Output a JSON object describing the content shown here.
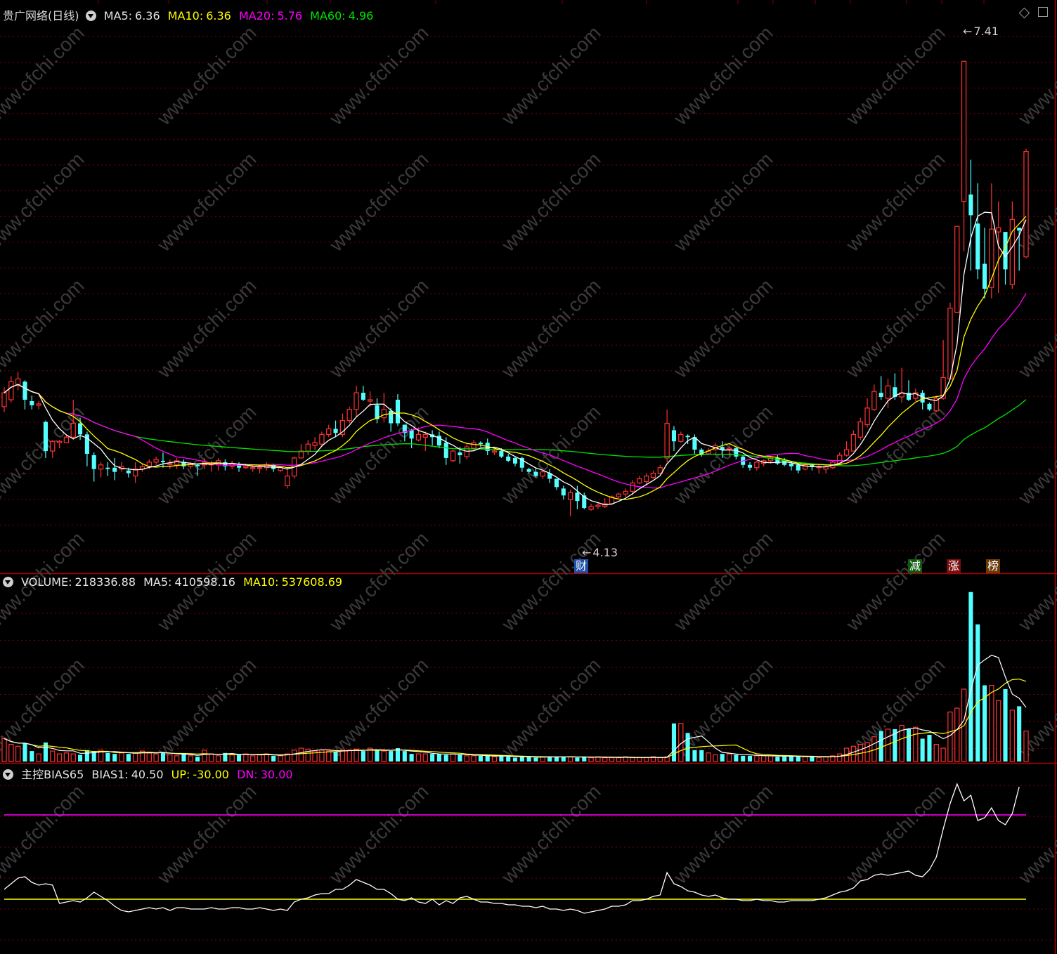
{
  "header": {
    "stock_name": "贵广网络(日线)",
    "ma5_label": "MA5:",
    "ma5_value": "6.36",
    "ma10_label": "MA10:",
    "ma10_value": "6.36",
    "ma20_label": "MA20:",
    "ma20_value": "5.76",
    "ma60_label": "MA60:",
    "ma60_value": "4.96"
  },
  "volume_header": {
    "label": "VOLUME:",
    "value": "218336.88",
    "ma5_label": "MA5:",
    "ma5_value": "410598.16",
    "ma10_label": "MA10:",
    "ma10_value": "537608.69"
  },
  "bias_header": {
    "name": "主控BIAS65",
    "bias1_label": "BIAS1:",
    "bias1_value": "40.50",
    "up_label": "UP:",
    "up_value": "-30.00",
    "dn_label": "DN:",
    "dn_value": "30.00"
  },
  "annotations": {
    "high_label": "7.41",
    "low_label": "4.13",
    "event_cai": "财",
    "event_jian": "减",
    "event_zhang": "涨",
    "event_bang": "榜"
  },
  "watermark": "www.cfchi.com",
  "colors": {
    "up": "#ff3232",
    "down": "#54ffff",
    "ma5": "#ffffff",
    "ma10": "#ffff00",
    "ma20": "#ff00ff",
    "ma60": "#00e600",
    "grid": "#7a0000",
    "frame": "#b00000",
    "up_line": "#ffff00",
    "dn_line": "#ff00ff"
  },
  "chart_data": [
    {
      "type": "candlestick",
      "title": "贵广网络(日线)",
      "y_range": [
        3.8,
        7.7
      ],
      "candles": [
        [
          4.92,
          5.02,
          5.06,
          4.88
        ],
        [
          4.97,
          5.1,
          5.14,
          4.95
        ],
        [
          5.08,
          5.12,
          5.17,
          5.04
        ],
        [
          5.1,
          4.97,
          5.11,
          4.9
        ],
        [
          4.96,
          4.93,
          5.0,
          4.9
        ],
        [
          4.93,
          4.94,
          4.96,
          4.9
        ],
        [
          4.81,
          4.6,
          4.82,
          4.55
        ],
        [
          4.6,
          4.67,
          4.68,
          4.55
        ],
        [
          4.66,
          4.67,
          4.68,
          4.62
        ],
        [
          4.66,
          4.7,
          4.72,
          4.66
        ],
        [
          4.7,
          4.8,
          4.97,
          4.68
        ],
        [
          4.8,
          4.72,
          4.84,
          4.68
        ],
        [
          4.72,
          4.58,
          4.74,
          4.49
        ],
        [
          4.57,
          4.47,
          4.59,
          4.38
        ],
        [
          4.47,
          4.5,
          4.52,
          4.41
        ],
        [
          4.48,
          4.47,
          4.52,
          4.42
        ],
        [
          4.48,
          4.45,
          4.55,
          4.39
        ],
        [
          4.47,
          4.49,
          4.52,
          4.45
        ],
        [
          4.46,
          4.44,
          4.48,
          4.41
        ],
        [
          4.42,
          4.47,
          4.52,
          4.37
        ],
        [
          4.47,
          4.49,
          4.51,
          4.45
        ],
        [
          4.49,
          4.52,
          4.54,
          4.47
        ],
        [
          4.52,
          4.54,
          4.56,
          4.5
        ],
        [
          4.53,
          4.52,
          4.59,
          4.48
        ],
        [
          4.51,
          4.51,
          4.54,
          4.47
        ],
        [
          4.5,
          4.53,
          4.55,
          4.47
        ],
        [
          4.52,
          4.49,
          4.54,
          4.47
        ],
        [
          4.49,
          4.51,
          4.52,
          4.47
        ],
        [
          4.5,
          4.49,
          4.51,
          4.42
        ],
        [
          4.5,
          4.52,
          4.55,
          4.47
        ],
        [
          4.5,
          4.51,
          4.53,
          4.45
        ],
        [
          4.5,
          4.53,
          4.55,
          4.46
        ],
        [
          4.52,
          4.49,
          4.54,
          4.46
        ],
        [
          4.49,
          4.51,
          4.53,
          4.47
        ],
        [
          4.5,
          4.48,
          4.52,
          4.45
        ],
        [
          4.48,
          4.49,
          4.51,
          4.47
        ],
        [
          4.48,
          4.48,
          4.5,
          4.45
        ],
        [
          4.48,
          4.48,
          4.5,
          4.44
        ],
        [
          4.48,
          4.5,
          4.52,
          4.46
        ],
        [
          4.5,
          4.47,
          4.51,
          4.45
        ],
        [
          4.46,
          4.48,
          4.49,
          4.45
        ],
        [
          4.35,
          4.42,
          4.48,
          4.33
        ],
        [
          4.42,
          4.55,
          4.56,
          4.4
        ],
        [
          4.55,
          4.6,
          4.65,
          4.55
        ],
        [
          4.6,
          4.65,
          4.68,
          4.57
        ],
        [
          4.64,
          4.66,
          4.7,
          4.61
        ],
        [
          4.65,
          4.72,
          4.74,
          4.63
        ],
        [
          4.72,
          4.76,
          4.79,
          4.7
        ],
        [
          4.76,
          4.73,
          4.82,
          4.7
        ],
        [
          4.72,
          4.82,
          4.87,
          4.7
        ],
        [
          4.82,
          4.9,
          4.92,
          4.8
        ],
        [
          4.9,
          5.02,
          5.07,
          4.85
        ],
        [
          5.02,
          4.97,
          5.07,
          4.96
        ],
        [
          4.96,
          4.97,
          5.03,
          4.92
        ],
        [
          4.93,
          4.83,
          4.98,
          4.8
        ],
        [
          4.84,
          4.9,
          5.02,
          4.81
        ],
        [
          4.89,
          4.8,
          4.91,
          4.74
        ],
        [
          4.97,
          4.8,
          5.01,
          4.78
        ],
        [
          4.79,
          4.73,
          4.79,
          4.67
        ],
        [
          4.75,
          4.69,
          4.76,
          4.62
        ],
        [
          4.68,
          4.72,
          4.77,
          4.67
        ],
        [
          4.7,
          4.72,
          4.74,
          4.6
        ],
        [
          4.72,
          4.7,
          4.75,
          4.64
        ],
        [
          4.71,
          4.64,
          4.74,
          4.62
        ],
        [
          4.66,
          4.55,
          4.7,
          4.5
        ],
        [
          4.53,
          4.6,
          4.61,
          4.52
        ],
        [
          4.59,
          4.57,
          4.63,
          4.51
        ],
        [
          4.56,
          4.63,
          4.65,
          4.54
        ],
        [
          4.62,
          4.66,
          4.68,
          4.6
        ],
        [
          4.66,
          4.65,
          4.67,
          4.63
        ],
        [
          4.66,
          4.6,
          4.69,
          4.57
        ],
        [
          4.6,
          4.6,
          4.62,
          4.57
        ],
        [
          4.6,
          4.56,
          4.62,
          4.55
        ],
        [
          4.56,
          4.53,
          4.58,
          4.52
        ],
        [
          4.55,
          4.51,
          4.56,
          4.49
        ],
        [
          4.55,
          4.48,
          4.56,
          4.45
        ],
        [
          4.47,
          4.45,
          4.48,
          4.44
        ],
        [
          4.45,
          4.42,
          4.48,
          4.41
        ],
        [
          4.42,
          4.45,
          4.46,
          4.4
        ],
        [
          4.44,
          4.4,
          4.47,
          4.37
        ],
        [
          4.4,
          4.34,
          4.4,
          4.32
        ],
        [
          4.33,
          4.28,
          4.35,
          4.25
        ],
        [
          4.25,
          4.3,
          4.32,
          4.13
        ],
        [
          4.3,
          4.24,
          4.35,
          4.18
        ],
        [
          4.28,
          4.19,
          4.3,
          4.18
        ],
        [
          4.18,
          4.2,
          4.22,
          4.17
        ],
        [
          4.2,
          4.21,
          4.23,
          4.18
        ],
        [
          4.2,
          4.22,
          4.26,
          4.19
        ],
        [
          4.22,
          4.27,
          4.28,
          4.21
        ],
        [
          4.27,
          4.29,
          4.3,
          4.26
        ],
        [
          4.29,
          4.31,
          4.33,
          4.27
        ],
        [
          4.31,
          4.37,
          4.39,
          4.28
        ],
        [
          4.37,
          4.4,
          4.42,
          4.36
        ],
        [
          4.38,
          4.42,
          4.44,
          4.35
        ],
        [
          4.41,
          4.44,
          4.46,
          4.4
        ],
        [
          4.44,
          4.48,
          4.5,
          4.43
        ],
        [
          4.55,
          4.8,
          4.9,
          4.52
        ],
        [
          4.75,
          4.67,
          4.78,
          4.6
        ],
        [
          4.67,
          4.72,
          4.74,
          4.66
        ],
        [
          4.71,
          4.7,
          4.72,
          4.65
        ],
        [
          4.7,
          4.61,
          4.72,
          4.58
        ],
        [
          4.61,
          4.57,
          4.62,
          4.56
        ],
        [
          4.58,
          4.6,
          4.62,
          4.57
        ],
        [
          4.61,
          4.64,
          4.66,
          4.6
        ],
        [
          4.63,
          4.61,
          4.67,
          4.55
        ],
        [
          4.62,
          4.62,
          4.63,
          4.56
        ],
        [
          4.62,
          4.56,
          4.63,
          4.54
        ],
        [
          4.56,
          4.5,
          4.57,
          4.48
        ],
        [
          4.5,
          4.48,
          4.52,
          4.46
        ],
        [
          4.48,
          4.52,
          4.53,
          4.46
        ],
        [
          4.51,
          4.53,
          4.54,
          4.49
        ],
        [
          4.53,
          4.55,
          4.56,
          4.51
        ],
        [
          4.55,
          4.51,
          4.57,
          4.5
        ],
        [
          4.53,
          4.5,
          4.55,
          4.49
        ],
        [
          4.51,
          4.49,
          4.53,
          4.46
        ],
        [
          4.5,
          4.46,
          4.51,
          4.44
        ],
        [
          4.47,
          4.5,
          4.52,
          4.46
        ],
        [
          4.5,
          4.49,
          4.51,
          4.46
        ],
        [
          4.48,
          4.49,
          4.5,
          4.44
        ],
        [
          4.47,
          4.49,
          4.5,
          4.44
        ],
        [
          4.48,
          4.52,
          4.53,
          4.47
        ],
        [
          4.51,
          4.57,
          4.59,
          4.5
        ],
        [
          4.57,
          4.61,
          4.67,
          4.56
        ],
        [
          4.6,
          4.72,
          4.75,
          4.6
        ],
        [
          4.7,
          4.81,
          4.84,
          4.68
        ],
        [
          4.79,
          4.91,
          4.98,
          4.77
        ],
        [
          4.9,
          5.03,
          5.08,
          4.89
        ],
        [
          5.02,
          4.99,
          5.14,
          4.97
        ],
        [
          4.98,
          5.07,
          5.12,
          4.91
        ],
        [
          5.06,
          4.99,
          5.16,
          4.97
        ],
        [
          4.99,
          5.02,
          5.2,
          4.95
        ],
        [
          5.02,
          4.97,
          5.11,
          4.96
        ],
        [
          4.98,
          5.02,
          5.05,
          4.96
        ],
        [
          5.02,
          4.95,
          5.04,
          4.9
        ],
        [
          4.94,
          4.9,
          4.95,
          4.89
        ],
        [
          4.89,
          4.98,
          5.0,
          4.88
        ],
        [
          4.98,
          5.13,
          5.4,
          4.97
        ],
        [
          5.12,
          5.63,
          5.67,
          5.12
        ],
        [
          5.6,
          6.22,
          6.22,
          5.6
        ],
        [
          6.4,
          7.41,
          7.41,
          6.04
        ],
        [
          6.45,
          6.3,
          6.7,
          5.9
        ],
        [
          6.24,
          5.91,
          6.53,
          5.84
        ],
        [
          5.95,
          5.77,
          6.21,
          5.7
        ],
        [
          5.78,
          6.2,
          6.53,
          5.7
        ],
        [
          6.18,
          6.21,
          6.4,
          5.74
        ],
        [
          6.18,
          5.91,
          6.15,
          5.8
        ],
        [
          5.8,
          6.27,
          6.4,
          5.77
        ],
        [
          6.21,
          6.19,
          6.21,
          5.9
        ],
        [
          6.0,
          6.76,
          6.78,
          5.99
        ]
      ]
    },
    {
      "type": "bar",
      "title": "VOLUME",
      "y_range": [
        0,
        900000
      ],
      "values": [
        120000,
        90000,
        80000,
        95000,
        55000,
        40000,
        100000,
        55000,
        40000,
        45000,
        40000,
        35000,
        60000,
        55000,
        60000,
        45000,
        40000,
        45000,
        40000,
        45000,
        55000,
        45000,
        40000,
        50000,
        35000,
        30000,
        40000,
        30000,
        25000,
        60000,
        40000,
        30000,
        45000,
        35000,
        35000,
        40000,
        30000,
        35000,
        40000,
        30000,
        30000,
        40000,
        60000,
        70000,
        65000,
        55000,
        60000,
        55000,
        50000,
        60000,
        60000,
        65000,
        55000,
        70000,
        60000,
        55000,
        55000,
        70000,
        55000,
        40000,
        40000,
        40000,
        40000,
        40000,
        35000,
        40000,
        35000,
        30000,
        30000,
        30000,
        30000,
        25000,
        30000,
        25000,
        20000,
        25000,
        25000,
        20000,
        25000,
        25000,
        25000,
        25000,
        25000,
        20000,
        25000,
        20000,
        25000,
        20000,
        20000,
        20000,
        25000,
        20000,
        20000,
        20000,
        25000,
        20000,
        25000,
        200000,
        200000,
        150000,
        60000,
        60000,
        45000,
        35000,
        40000,
        40000,
        35000,
        30000,
        30000,
        30000,
        30000,
        30000,
        25000,
        25000,
        30000,
        25000,
        25000,
        25000,
        20000,
        25000,
        30000,
        40000,
        70000,
        80000,
        90000,
        100000,
        130000,
        160000,
        170000,
        170000,
        190000,
        170000,
        180000,
        120000,
        140000,
        90000,
        70000,
        260000,
        280000,
        380000,
        890000,
        720000,
        400000,
        400000,
        320000,
        380000,
        270000,
        290000,
        160000
      ]
    },
    {
      "type": "line",
      "title": "主控BIAS65",
      "y_range": [
        -65,
        55
      ],
      "series": [
        {
          "name": "BIAS1",
          "values": [
            -23,
            -19,
            -15,
            -14,
            -18,
            -20,
            -19,
            -20,
            -33,
            -32,
            -31,
            -32,
            -29,
            -25,
            -28,
            -31,
            -35,
            -38,
            -39,
            -38,
            -37,
            -36,
            -37,
            -36,
            -38,
            -36,
            -36,
            -37,
            -37,
            -37,
            -36,
            -37,
            -37,
            -36,
            -36,
            -37,
            -37,
            -36,
            -37,
            -38,
            -37,
            -38,
            -32,
            -30,
            -29,
            -27,
            -26,
            -26,
            -23,
            -23,
            -20,
            -16,
            -18,
            -20,
            -23,
            -23,
            -26,
            -30,
            -31,
            -29,
            -32,
            -33,
            -30,
            -34,
            -31,
            -33,
            -29,
            -28,
            -30,
            -32,
            -32,
            -33,
            -33,
            -34,
            -34,
            -35,
            -35,
            -36,
            -35,
            -37,
            -37,
            -38,
            -37,
            -38,
            -40,
            -39,
            -38,
            -37,
            -35,
            -35,
            -34,
            -31,
            -31,
            -30,
            -28,
            -27,
            -11,
            -19,
            -21,
            -24,
            -25,
            -27,
            -28,
            -27,
            -29,
            -30,
            -30,
            -31,
            -31,
            -30,
            -31,
            -31,
            -32,
            -32,
            -31,
            -31,
            -31,
            -31,
            -30,
            -29,
            -27,
            -25,
            -24,
            -22,
            -17,
            -16,
            -13,
            -12,
            -13,
            -12,
            -11,
            -10,
            -13,
            -14,
            -9,
            0,
            20,
            38,
            52,
            40,
            44,
            26,
            28,
            35,
            26,
            23,
            31,
            50
          ]
        },
        {
          "name": "UP",
          "values": [
            -30
          ]
        },
        {
          "name": "DN",
          "values": [
            30
          ]
        }
      ]
    }
  ]
}
